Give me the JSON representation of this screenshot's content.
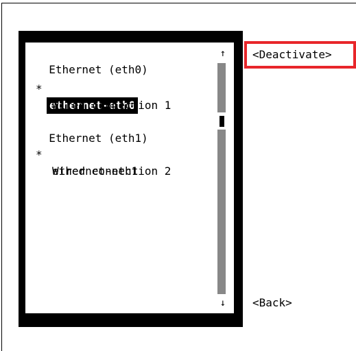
{
  "list": {
    "items": [
      {
        "type": "header",
        "label": "Ethernet (eth0)"
      },
      {
        "type": "connection",
        "marker": "*",
        "label": "ethernet-eth0",
        "selected": true
      },
      {
        "type": "connection",
        "marker": "",
        "label": "Wired connection 1",
        "selected": false
      },
      {
        "type": "header",
        "label": "Ethernet (eth1)"
      },
      {
        "type": "connection",
        "marker": "*",
        "label": "ethernet-eth1",
        "selected": false
      },
      {
        "type": "connection",
        "marker": "",
        "label": "Wired connection 2",
        "selected": false
      }
    ]
  },
  "scrollbar": {
    "up_arrow": "↑",
    "down_arrow": "↓"
  },
  "buttons": {
    "deactivate": "<Deactivate>",
    "back": "<Back>"
  },
  "colors": {
    "highlight": "#e8262a",
    "frame": "#000000",
    "scroll_track": "#888888"
  }
}
